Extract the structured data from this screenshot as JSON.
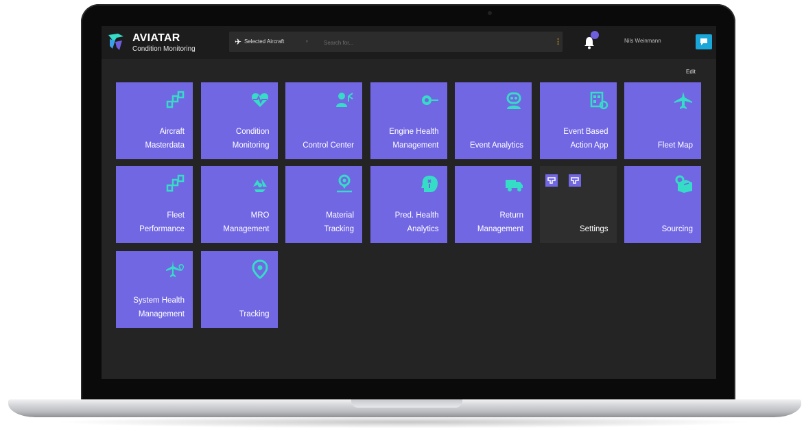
{
  "header": {
    "brand_title": "AVIATAR",
    "brand_subtitle": "Condition Monitoring",
    "selected_aircraft_label": "Selected Aircraft",
    "search_placeholder": "Search for...",
    "user_name": "Nils Weinmann"
  },
  "dashboard": {
    "edit_label": "Edit"
  },
  "tiles": [
    {
      "line1": "Aircraft",
      "line2": "Masterdata",
      "icon": "nodes-icon"
    },
    {
      "line1": "Condition",
      "line2": "Monitoring",
      "icon": "heartbeat-icon"
    },
    {
      "line1": "",
      "line2": "Control Center",
      "icon": "person-network-icon"
    },
    {
      "line1": "Engine Health",
      "line2": "Management",
      "icon": "engine-icon"
    },
    {
      "line1": "",
      "line2": "Event Analytics",
      "icon": "robot-icon"
    },
    {
      "line1": "Event Based",
      "line2": "Action App",
      "icon": "checklist-icon"
    },
    {
      "line1": "",
      "line2": "Fleet Map",
      "icon": "airplane-icon"
    },
    {
      "line1": "Fleet",
      "line2": "Performance",
      "icon": "nodes-icon"
    },
    {
      "line1": "MRO",
      "line2": "Management",
      "icon": "recycle-icon"
    },
    {
      "line1": "Material",
      "line2": "Tracking",
      "icon": "location-person-icon"
    },
    {
      "line1": "Pred. Health",
      "line2": "Analytics",
      "icon": "brain-head-icon"
    },
    {
      "line1": "Return",
      "line2": "Management",
      "icon": "truck-icon"
    },
    {
      "line1": "",
      "line2": "Settings",
      "icon": "settings-icon"
    },
    {
      "line1": "",
      "line2": "Sourcing",
      "icon": "box-gear-icon"
    },
    {
      "line1": "System Health",
      "line2": "Management",
      "icon": "plane-heart-icon"
    },
    {
      "line1": "",
      "line2": "Tracking",
      "icon": "map-pin-icon"
    }
  ],
  "colors": {
    "tile": "#7267e3",
    "icon": "#35dcc6",
    "screen_bg": "#242424",
    "chat_button": "#19a6d8"
  }
}
